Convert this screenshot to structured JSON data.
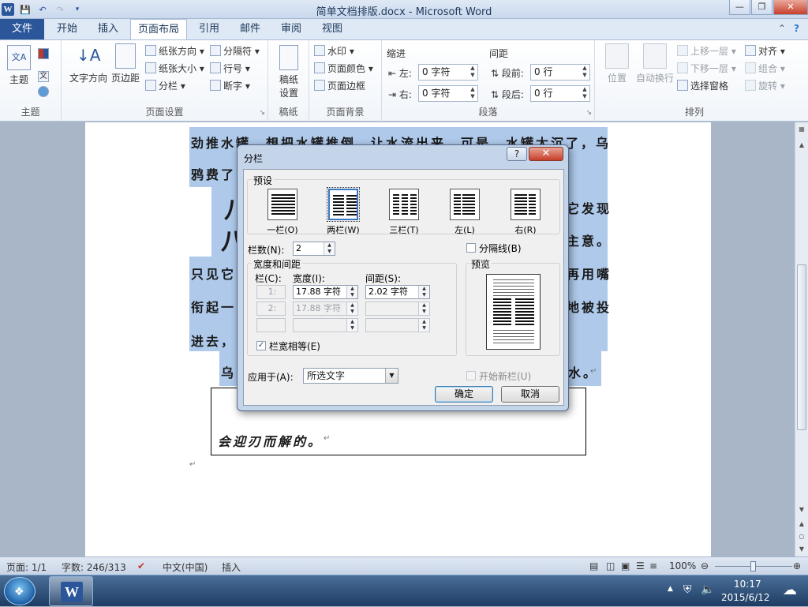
{
  "window": {
    "title": "简单文档排版.docx - Microsoft Word",
    "app_icon": "W",
    "controls": {
      "minimize": "—",
      "restore": "❐",
      "close": "✕"
    }
  },
  "tabs": {
    "file": "文件",
    "items": [
      "开始",
      "插入",
      "页面布局",
      "引用",
      "邮件",
      "审阅",
      "视图"
    ],
    "active": "页面布局"
  },
  "ribbon": {
    "theme_group": {
      "label": "主题",
      "btn": "主题"
    },
    "page_setup": {
      "label": "页面设置",
      "text_direction": "文字方向",
      "margins": "页边距",
      "orientation": "纸张方向",
      "size": "纸张大小",
      "columns": "分栏",
      "breaks": "分隔符",
      "line_numbers": "行号",
      "hyphenation": "断字"
    },
    "manuscript": {
      "label": "稿纸",
      "btn_line1": "稿纸",
      "btn_line2": "设置"
    },
    "page_background": {
      "label": "页面背景",
      "watermark": "水印",
      "page_color": "页面颜色",
      "page_borders": "页面边框"
    },
    "paragraph": {
      "label": "段落",
      "indent_title": "缩进",
      "spacing_title": "间距",
      "left_label": "左:",
      "left_value": "0 字符",
      "right_label": "右:",
      "right_value": "0 字符",
      "before_label": "段前:",
      "before_value": "0 行",
      "after_label": "段后:",
      "after_value": "0 行"
    },
    "arrange": {
      "label": "排列",
      "position": "位置",
      "wrap_text": "自动换行",
      "bring_forward": "上移一层",
      "send_backward": "下移一层",
      "selection_pane": "选择窗格",
      "align": "对齐",
      "group": "组合",
      "rotate": "旋转"
    }
  },
  "document": {
    "line1": "劲推水罐，想把水罐推倒，让水流出来。可是，水罐太沉了，乌",
    "line2": "鸦费了",
    "big_char1": "八",
    "big_char2": "八",
    "line3_right": "它发现",
    "line4_right": "主意。",
    "line5_left": "只见它",
    "line5_right": "再用嘴",
    "line6_left": "衔起一",
    "line6_right": "地被投",
    "line7_left": "进去，",
    "line8_left": "乌",
    "line8_right": "水。",
    "box_line2": "会迎刃而解的。"
  },
  "dialog": {
    "title": "分栏",
    "help": "?",
    "close": "✕",
    "presets_label": "预设",
    "presets": [
      {
        "label": "一栏(O)",
        "cols": 1,
        "selected": false
      },
      {
        "label": "两栏(W)",
        "cols": 2,
        "selected": true
      },
      {
        "label": "三栏(T)",
        "cols": 3,
        "selected": false
      },
      {
        "label": "左(L)",
        "cols": 2,
        "selected": false
      },
      {
        "label": "右(R)",
        "cols": 2,
        "selected": false
      }
    ],
    "num_cols_label": "栏数(N):",
    "num_cols_value": "2",
    "separator_label": "分隔线(B)",
    "width_spacing_label": "宽度和间距",
    "col_header": "栏(C):",
    "width_header": "宽度(I):",
    "spacing_header": "间距(S):",
    "rows": [
      {
        "col": "1:",
        "width": "17.88 字符",
        "spacing": "2.02 字符"
      },
      {
        "col": "2:",
        "width": "17.88 字符",
        "spacing": ""
      },
      {
        "col": "",
        "width": "",
        "spacing": ""
      }
    ],
    "equal_width_label": "栏宽相等(E)",
    "preview_label": "预览",
    "apply_to_label": "应用于(A):",
    "apply_to_value": "所选文字",
    "new_column_label": "开始新栏(U)",
    "ok": "确定",
    "cancel": "取消"
  },
  "statusbar": {
    "page": "页面: 1/1",
    "words": "字数: 246/313",
    "language": "中文(中国)",
    "mode": "插入",
    "zoom": "100%"
  },
  "taskbar": {
    "time": "10:17",
    "date": "2015/6/12"
  }
}
